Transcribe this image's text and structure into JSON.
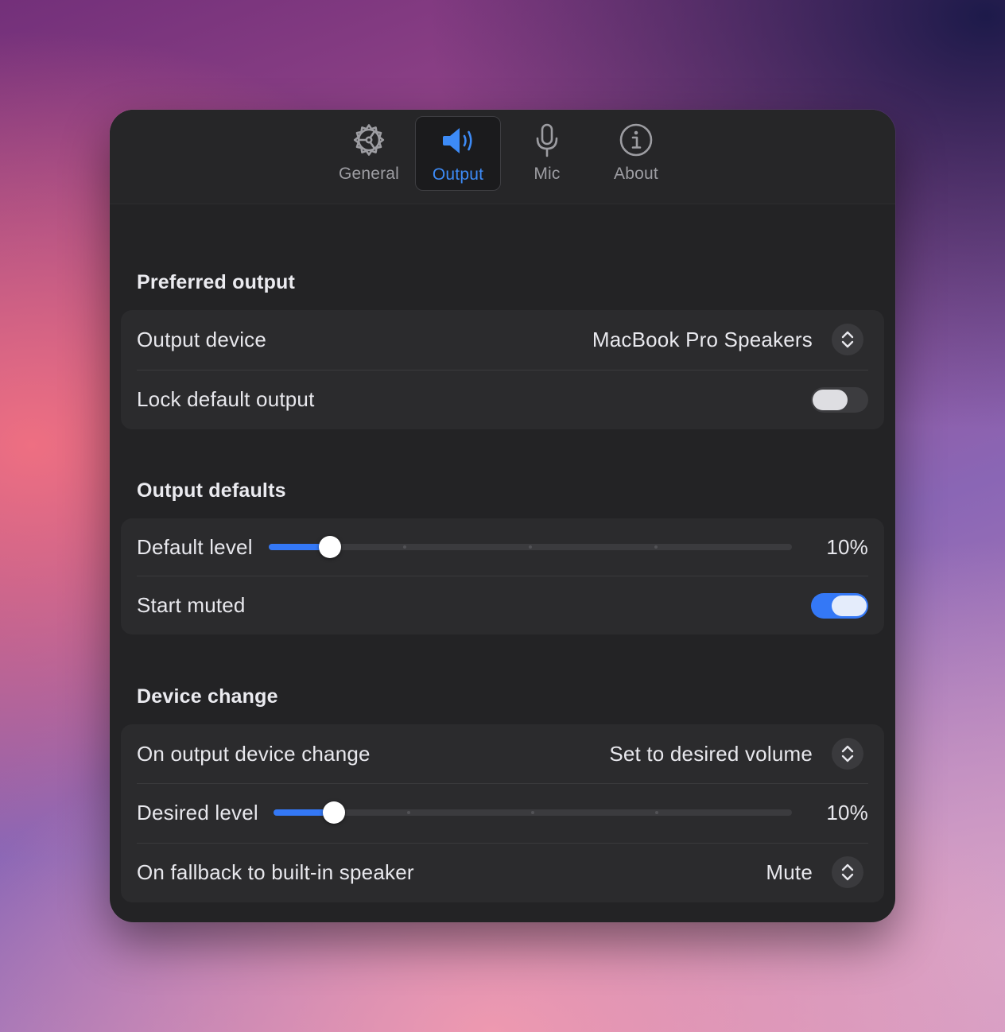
{
  "tabs": [
    {
      "label": "General",
      "icon": "gear-icon",
      "selected": false
    },
    {
      "label": "Output",
      "icon": "speaker-icon",
      "selected": true
    },
    {
      "label": "Mic",
      "icon": "microphone-icon",
      "selected": false
    },
    {
      "label": "About",
      "icon": "info-icon",
      "selected": false
    }
  ],
  "colors": {
    "accent": "#3478f6",
    "selected_tab_text": "#3d8bf7",
    "window_background": "#232325",
    "group_background": "#2b2b2d"
  },
  "preferred_output": {
    "title": "Preferred output",
    "output_device": {
      "label": "Output device",
      "value": "MacBook Pro Speakers"
    },
    "lock_default_output": {
      "label": "Lock default output",
      "on": false
    }
  },
  "output_defaults": {
    "title": "Output defaults",
    "default_level": {
      "label": "Default level",
      "value_text": "10%",
      "percent": 10
    },
    "start_muted": {
      "label": "Start muted",
      "on": true
    }
  },
  "device_change": {
    "title": "Device change",
    "on_output_device_change": {
      "label": "On output device change",
      "value": "Set to desired volume"
    },
    "desired_level": {
      "label": "Desired level",
      "value_text": "10%",
      "percent": 10
    },
    "on_fallback": {
      "label": "On fallback to built-in speaker",
      "value": "Mute"
    }
  }
}
